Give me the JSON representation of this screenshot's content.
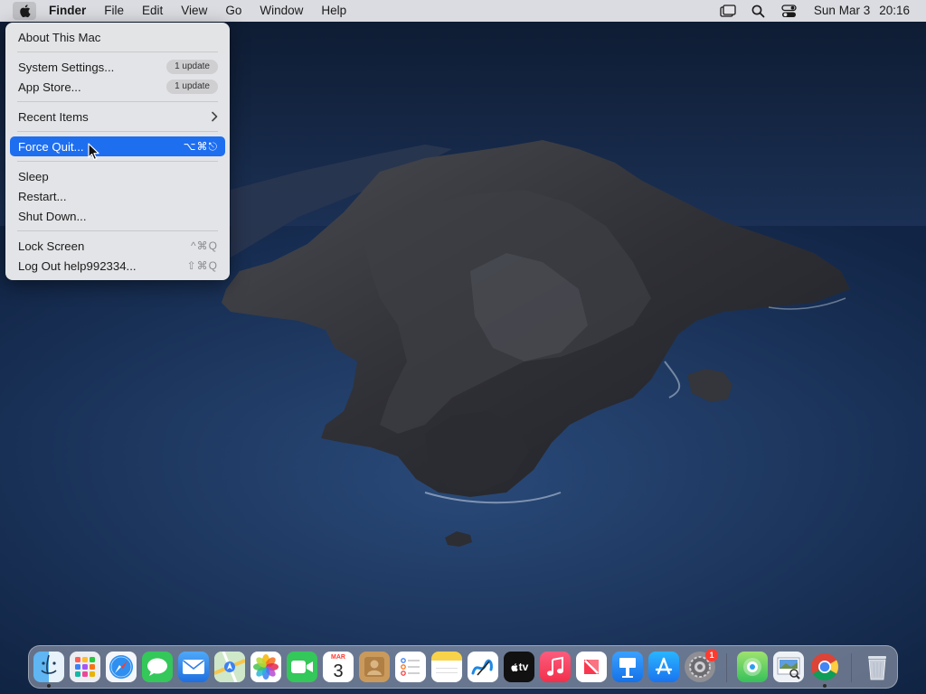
{
  "menubar": {
    "app_name": "Finder",
    "items": [
      "File",
      "Edit",
      "View",
      "Go",
      "Window",
      "Help"
    ],
    "status_icons": [
      "screen-mirroring-icon",
      "spotlight-search-icon",
      "control-center-icon"
    ],
    "clock": {
      "date": "Sun Mar 3",
      "time": "20:16"
    }
  },
  "apple_menu": {
    "about": "About This Mac",
    "system_settings": {
      "label": "System Settings...",
      "badge": "1 update"
    },
    "app_store": {
      "label": "App Store...",
      "badge": "1 update"
    },
    "recent_items": "Recent Items",
    "force_quit": {
      "label": "Force Quit...",
      "shortcut": "⌥⌘⎋"
    },
    "sleep": "Sleep",
    "restart": "Restart...",
    "shut_down": "Shut Down...",
    "lock_screen": {
      "label": "Lock Screen",
      "shortcut": "^⌘Q"
    },
    "log_out": {
      "label": "Log Out help992334...",
      "shortcut": "⇧⌘Q"
    }
  },
  "dock": {
    "calendar": {
      "month": "MAR",
      "day": "3"
    },
    "apple_tv_label": "tv",
    "system_settings_badge": "1",
    "apps": [
      "Finder",
      "Launchpad",
      "Safari",
      "Messages",
      "Mail",
      "Maps",
      "Photos",
      "FaceTime",
      "Calendar",
      "Contacts",
      "Reminders",
      "Notes",
      "Freeform",
      "TV",
      "Music",
      "News",
      "Keynote",
      "App Store",
      "System Settings",
      "Find My",
      "Preview",
      "Chrome",
      "Trash"
    ]
  },
  "colors": {
    "menu_highlight": "#1e6ef0",
    "badge_red": "#ff3b30"
  }
}
